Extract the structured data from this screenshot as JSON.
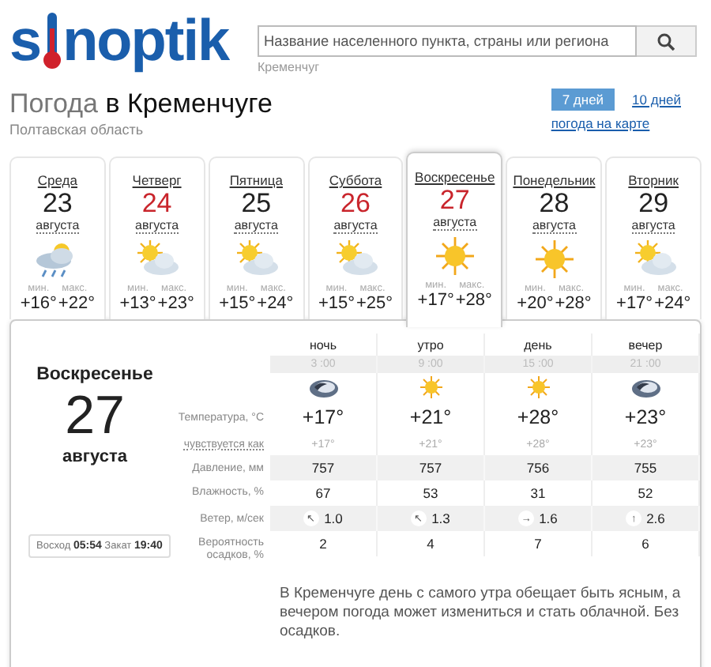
{
  "logo": {
    "left": "s",
    "right": "noptik"
  },
  "search": {
    "placeholder": "Название населенного пункта, страны или региона",
    "hint": "Кременчуг"
  },
  "title": {
    "prefix": "Погода",
    "city": "в Кременчуге",
    "region": "Полтавская область"
  },
  "views": [
    {
      "label": "7 дней",
      "selected": true
    },
    {
      "label": "10 дней",
      "selected": false
    }
  ],
  "map_link": "погода на карте",
  "days": [
    {
      "name": "Среда",
      "date": "23",
      "month": "августа",
      "holiday": false,
      "selected": false,
      "kind": "rain",
      "min_label": "мин.",
      "max_label": "макс.",
      "min": "+16°",
      "max": "+22°"
    },
    {
      "name": "Четверг",
      "date": "24",
      "month": "августа",
      "holiday": true,
      "selected": false,
      "kind": "partly",
      "min_label": "мин.",
      "max_label": "макс.",
      "min": "+13°",
      "max": "+23°"
    },
    {
      "name": "Пятница",
      "date": "25",
      "month": "августа",
      "holiday": false,
      "selected": false,
      "kind": "partly",
      "min_label": "мин.",
      "max_label": "макс.",
      "min": "+15°",
      "max": "+24°"
    },
    {
      "name": "Суббота",
      "date": "26",
      "month": "августа",
      "holiday": true,
      "selected": false,
      "kind": "partly",
      "min_label": "мин.",
      "max_label": "макс.",
      "min": "+15°",
      "max": "+25°"
    },
    {
      "name": "Воскресенье",
      "date": "27",
      "month": "августа",
      "holiday": true,
      "selected": true,
      "kind": "sun",
      "min_label": "мин.",
      "max_label": "макс.",
      "min": "+17°",
      "max": "+28°"
    },
    {
      "name": "Понедельник",
      "date": "28",
      "month": "августа",
      "holiday": false,
      "selected": false,
      "kind": "sun",
      "min_label": "мин.",
      "max_label": "макс.",
      "min": "+20°",
      "max": "+28°"
    },
    {
      "name": "Вторник",
      "date": "29",
      "month": "августа",
      "holiday": false,
      "selected": false,
      "kind": "partly",
      "min_label": "мин.",
      "max_label": "макс.",
      "min": "+17°",
      "max": "+24°"
    }
  ],
  "detail": {
    "day": "Воскресенье",
    "date": "27",
    "month": "августа",
    "sunrise_label": "Восход",
    "sunrise": "05:54",
    "sunset_label": "Закат",
    "sunset": "19:40",
    "periods": [
      {
        "name": "ночь",
        "time": "3 :00",
        "kind": "moon"
      },
      {
        "name": "утро",
        "time": "9 :00",
        "kind": "sunsmall"
      },
      {
        "name": "день",
        "time": "15 :00",
        "kind": "sunsmall"
      },
      {
        "name": "вечер",
        "time": "21 :00",
        "kind": "moon"
      }
    ],
    "rows": [
      {
        "kind": "temp",
        "label": "Температура, °C",
        "values": [
          "+17°",
          "+21°",
          "+28°",
          "+23°"
        ]
      },
      {
        "kind": "feels",
        "label": "чувствуется как",
        "values": [
          "+17°",
          "+21°",
          "+28°",
          "+23°"
        ]
      },
      {
        "kind": "shaded",
        "label": "Давление, мм",
        "values": [
          "757",
          "757",
          "756",
          "755"
        ]
      },
      {
        "kind": "plain",
        "label": "Влажность, %",
        "values": [
          "67",
          "53",
          "31",
          "52"
        ]
      },
      {
        "kind": "wind",
        "label": "Ветер, м/сек",
        "values": [
          "1.0",
          "1.3",
          "1.6",
          "2.6"
        ],
        "arrows": [
          "↖",
          "↖",
          "→",
          "↑"
        ]
      },
      {
        "kind": "plain",
        "label": "Вероятность осадков, %",
        "values": [
          "2",
          "4",
          "7",
          "6"
        ]
      }
    ],
    "description": "В Кременчуге день с самого утра обещает быть ясным, а вечером погода может измениться и стать облачной. Без осадков."
  }
}
